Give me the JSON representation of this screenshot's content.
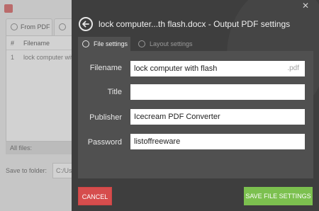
{
  "background_app": {
    "tabs": [
      {
        "label": "From PDF"
      }
    ],
    "list": {
      "headers": [
        "#",
        "Filename"
      ],
      "rows": [
        {
          "num": "1",
          "filename": "lock computer wit"
        }
      ]
    },
    "all_files_label": "All files:",
    "save_to_label": "Save to folder:",
    "save_to_value": "C:/Us"
  },
  "dialog": {
    "title": "lock computer...th flash.docx - Output PDF settings",
    "tabs": {
      "file_settings": "File settings",
      "layout_settings": "Layout settings"
    },
    "fields": {
      "filename": {
        "label": "Filename",
        "value": "lock computer with flash",
        "suffix": ".pdf"
      },
      "title": {
        "label": "Title",
        "value": ""
      },
      "publisher": {
        "label": "Publisher",
        "value": "Icecream PDF Converter"
      },
      "password": {
        "label": "Password",
        "value": "listoffreeware"
      }
    },
    "buttons": {
      "cancel": "CANCEL",
      "save": "SAVE FILE SETTINGS"
    }
  },
  "colors": {
    "panel": "#3e3e3e",
    "content": "#505050",
    "cancel": "#d64d4d",
    "save": "#7cc04f"
  }
}
